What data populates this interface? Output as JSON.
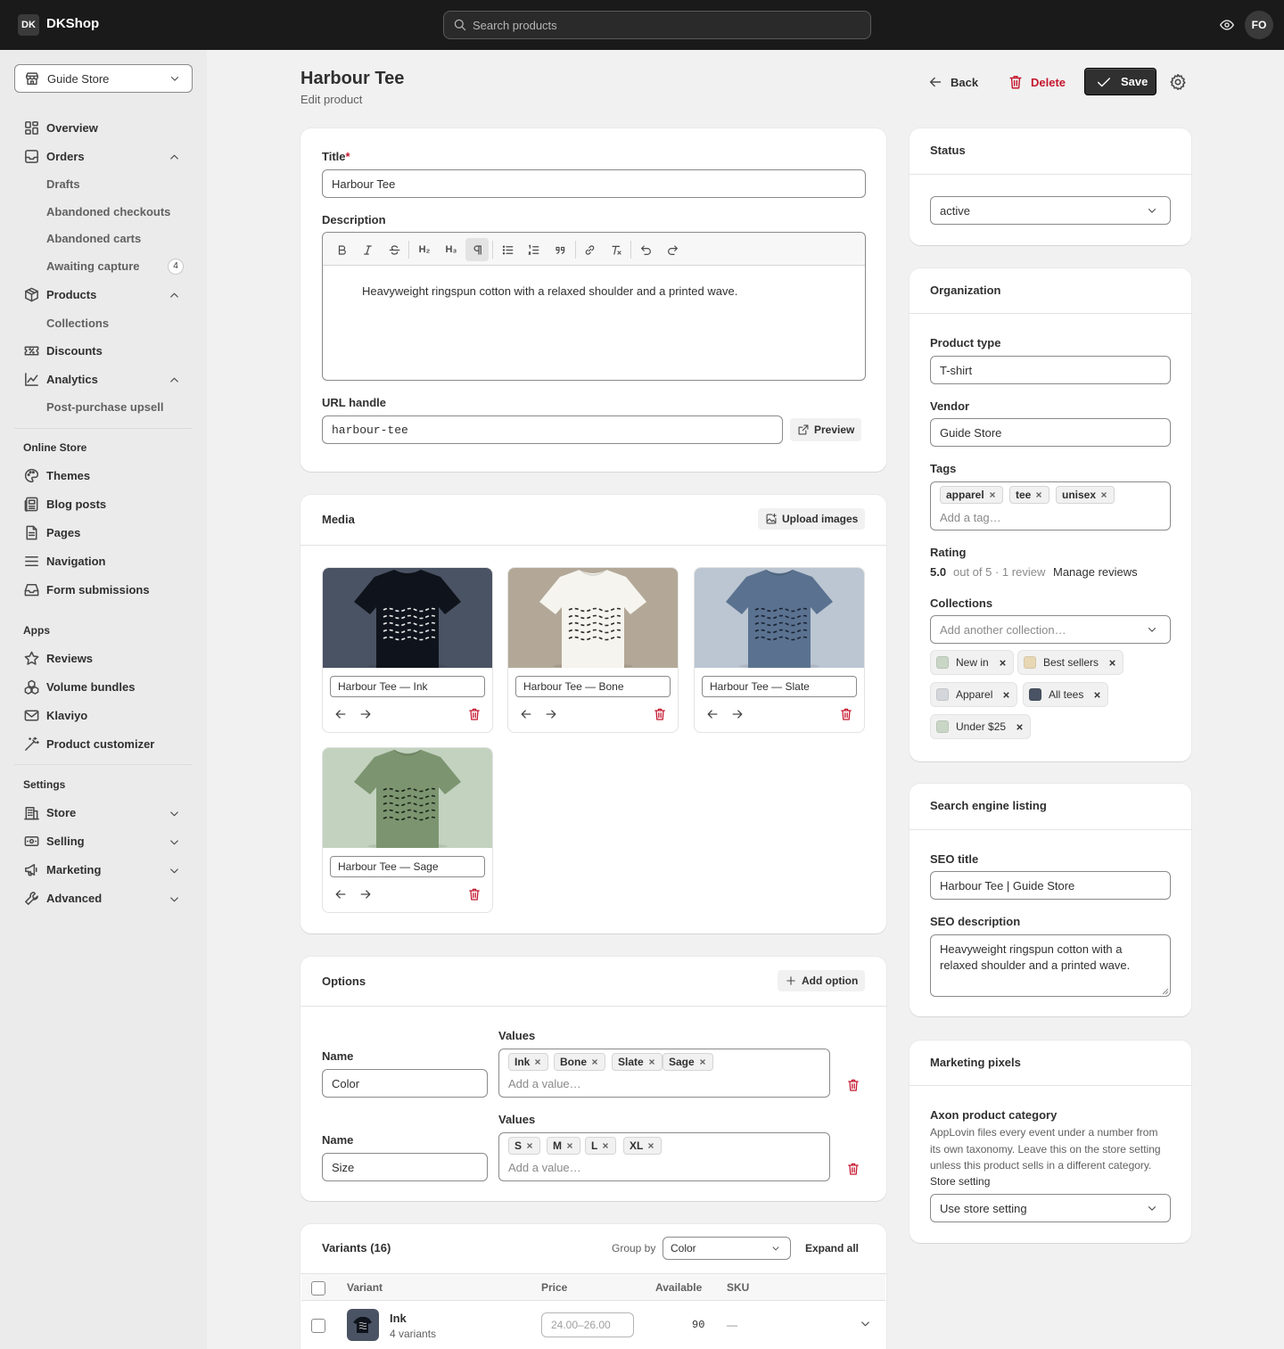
{
  "topbar": {
    "logo": "DK",
    "app_name": "DKShop",
    "search_placeholder": "Search products",
    "avatar": "FO"
  },
  "sidebar": {
    "store": "Guide Store",
    "items": {
      "overview": "Overview",
      "orders": "Orders",
      "drafts": "Drafts",
      "abandoned_checkouts": "Abandoned checkouts",
      "abandoned_carts": "Abandoned carts",
      "awaiting_capture": "Awaiting capture",
      "awaiting_capture_count": "4",
      "products": "Products",
      "collections": "Collections",
      "discounts": "Discounts",
      "analytics": "Analytics",
      "post_purchase": "Post-purchase upsell"
    },
    "online_store": {
      "heading": "Online Store",
      "themes": "Themes",
      "blog_posts": "Blog posts",
      "pages": "Pages",
      "navigation": "Navigation",
      "form_submissions": "Form submissions"
    },
    "apps": {
      "heading": "Apps",
      "reviews": "Reviews",
      "volume_bundles": "Volume bundles",
      "klaviyo": "Klaviyo",
      "product_customizer": "Product customizer"
    },
    "settings": {
      "heading": "Settings",
      "store": "Store",
      "selling": "Selling",
      "marketing": "Marketing",
      "advanced": "Advanced"
    }
  },
  "header": {
    "title": "Harbour Tee",
    "subtitle": "Edit product",
    "back": "Back",
    "delete": "Delete",
    "save": "Save"
  },
  "product": {
    "title_label": "Title",
    "title_required": "*",
    "title": "Harbour Tee",
    "description_label": "Description",
    "description": "Heavyweight ringspun cotton with a relaxed shoulder and a printed wave.",
    "toolbar": {
      "h2": "H₂",
      "h3": "H₃"
    },
    "url_label": "URL handle",
    "url": "harbour-tee",
    "preview": "Preview"
  },
  "media": {
    "title": "Media",
    "upload": "Upload images",
    "items": [
      {
        "alt": "Harbour Tee — Ink",
        "bg": "#4a5363",
        "shirt": "#0f141c",
        "wave": "#e8e8e8"
      },
      {
        "alt": "Harbour Tee — Bone",
        "bg": "#b3a898",
        "shirt": "#f6f4ee",
        "wave": "#2a2a2a"
      },
      {
        "alt": "Harbour Tee — Slate",
        "bg": "#bcc6d2",
        "shirt": "#5a7290",
        "wave": "#1a2230"
      },
      {
        "alt": "Harbour Tee — Sage",
        "bg": "#c3d2bf",
        "shirt": "#7c9570",
        "wave": "#1a2418"
      }
    ]
  },
  "options": {
    "title": "Options",
    "add": "Add option",
    "name_label": "Name",
    "values_label": "Values",
    "add_value_placeholder": "Add a value…",
    "list": [
      {
        "name": "Color",
        "values": [
          "Ink",
          "Bone",
          "Slate",
          "Sage"
        ]
      },
      {
        "name": "Size",
        "values": [
          "S",
          "M",
          "L",
          "XL"
        ]
      }
    ]
  },
  "variants": {
    "title": "Variants (16)",
    "group_by_label": "Group by",
    "group_by": "Color",
    "expand_all": "Expand all",
    "columns": {
      "variant": "Variant",
      "price": "Price",
      "available": "Available",
      "sku": "SKU"
    },
    "rows": [
      {
        "name": "Ink",
        "count": "4 variants",
        "price_placeholder": "24.00–26.00",
        "available": "90",
        "sku": "—"
      }
    ]
  },
  "status": {
    "title": "Status",
    "value": "active"
  },
  "organization": {
    "title": "Organization",
    "product_type_label": "Product type",
    "product_type": "T-shirt",
    "vendor_label": "Vendor",
    "vendor": "Guide Store",
    "tags_label": "Tags",
    "tags": [
      "apparel",
      "tee",
      "unisex"
    ],
    "add_tag_placeholder": "Add a tag…",
    "rating_label": "Rating",
    "rating": "5.0",
    "rating_meta": "out of 5 · 1 review",
    "manage_reviews": "Manage reviews",
    "collections_label": "Collections",
    "collections_placeholder": "Add another collection…",
    "collections": [
      {
        "name": "New in",
        "color": "#c9d6c6"
      },
      {
        "name": "Best sellers",
        "color": "#e8d7b5"
      },
      {
        "name": "Apparel",
        "color": "#d3d6da"
      },
      {
        "name": "All tees",
        "color": "#4a5363"
      },
      {
        "name": "Under $25",
        "color": "#c9d6c6"
      }
    ]
  },
  "seo": {
    "title": "Search engine listing",
    "seo_title_label": "SEO title",
    "seo_title": "Harbour Tee | Guide Store",
    "seo_desc_label": "SEO description",
    "seo_desc": "Heavyweight ringspun cotton with a relaxed shoulder and a printed wave."
  },
  "pixels": {
    "title": "Marketing pixels",
    "axon_label": "Axon product category",
    "axon_help": "AppLovin files every event under a number from its own taxonomy. Leave this on the store setting unless this product sells in a different category.",
    "store_setting_label": "Store setting",
    "store_setting": "Use store setting"
  }
}
